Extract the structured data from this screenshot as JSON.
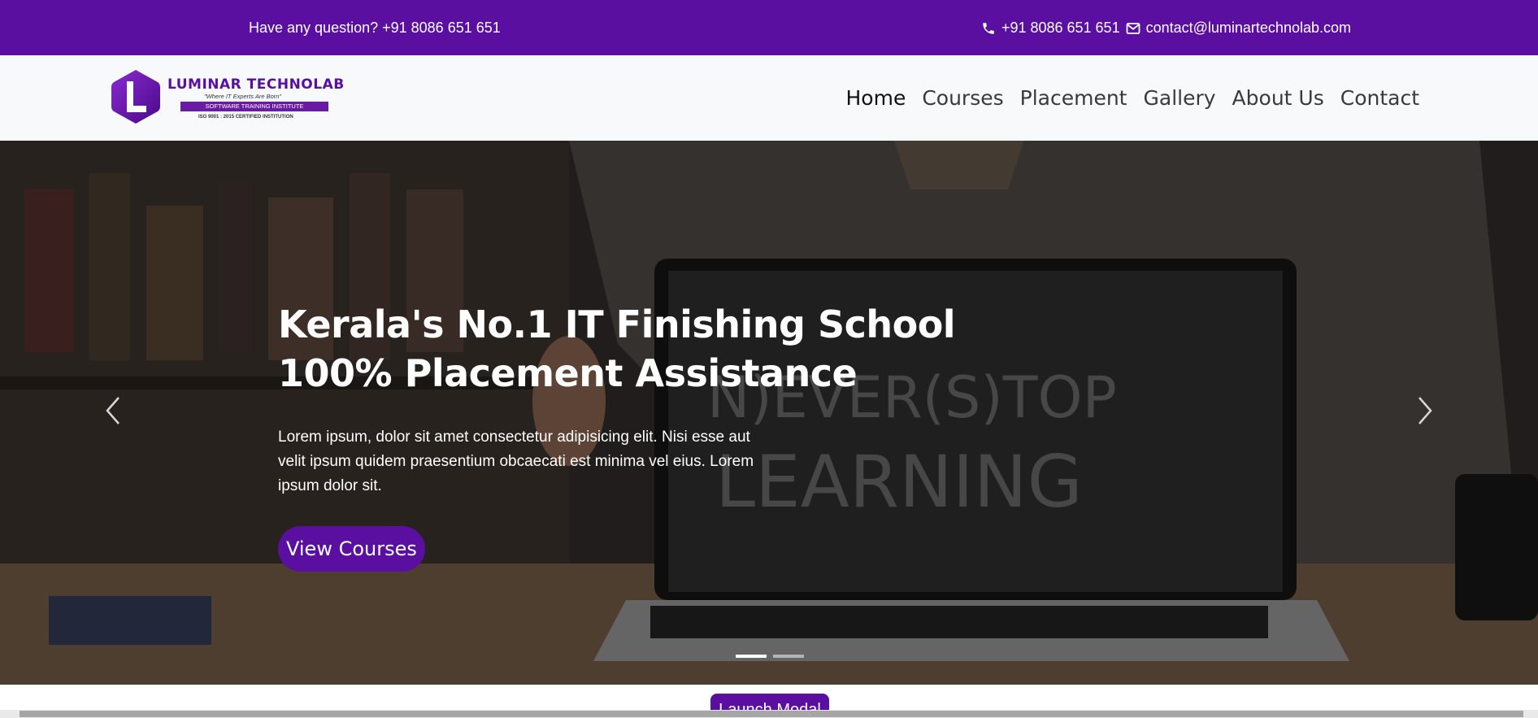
{
  "topbar": {
    "question": "Have any question? +91 8086 651 651",
    "phone": "+91 8086 651 651",
    "email": "contact@luminartechnolab.com",
    "phone_icon": "phone-icon",
    "email_icon": "envelope-icon"
  },
  "logo": {
    "letter": "L",
    "brand": "LUMINAR TECHNOLAB",
    "tagline": "\"Where IT Experts Are Born\"",
    "strip": "SOFTWARE TRAINING INSTITUTE",
    "iso": "ISO 9001 : 2015 CERTIFIED INSTITUTION"
  },
  "nav": {
    "items": [
      {
        "label": "Home"
      },
      {
        "label": "Courses"
      },
      {
        "label": "Placement"
      },
      {
        "label": "Gallery"
      },
      {
        "label": "About Us"
      },
      {
        "label": "Contact"
      }
    ]
  },
  "hero": {
    "title_line1": "Kerala's No.1 IT Finishing School",
    "title_line2": "100% Placement Assistance",
    "description": "Lorem ipsum, dolor sit amet consectetur adipisicing elit. Nisi esse aut velit ipsum quidem praesentium obcaecati est minima vel eius. Lorem ipsum dolor sit.",
    "cta": "View Courses",
    "chalk_text_line1": "N)EVER(S)TOP",
    "chalk_text_line2": "LEARNING",
    "slides": 2,
    "active_slide": 1
  },
  "bottom": {
    "button_label": "Launch Modal"
  },
  "colors": {
    "brand": "#5a0fa0",
    "navbar_bg": "#f8f9fa"
  }
}
